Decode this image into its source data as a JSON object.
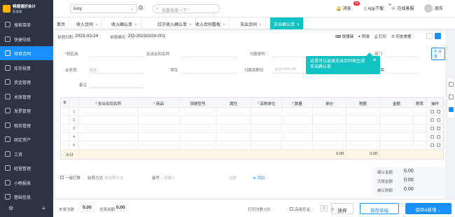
{
  "app": {
    "logo_name": "畅捷通好会计",
    "logo_edition": "标准版"
  },
  "topbar": {
    "company": "liuxy",
    "search_placeholder": "我要找单一下",
    "message_label": "消息",
    "message_count": "29",
    "app_label": "App下载",
    "service_label": "在线客服",
    "user_name": "周东"
  },
  "sidebar": {
    "items": [
      {
        "label": "搜索菜单"
      },
      {
        "label": "快捷导航"
      },
      {
        "label": "项目合同",
        "active": true
      },
      {
        "label": "库存核算"
      },
      {
        "label": "资金管理"
      },
      {
        "label": "总账管理"
      },
      {
        "label": "发票管理"
      },
      {
        "label": "税务管理"
      },
      {
        "label": "固定资产"
      },
      {
        "label": "工资"
      },
      {
        "label": "经营管理"
      },
      {
        "label": "小畅报表"
      },
      {
        "label": "基础信息"
      }
    ]
  },
  "tabs": [
    {
      "label": "首页",
      "closable": false
    },
    {
      "label": "收入合同",
      "closable": true
    },
    {
      "label": "收入确认单",
      "closable": true
    },
    {
      "label": "红字收入确认单",
      "closable": true
    },
    {
      "label": "收入合同看板",
      "closable": true
    },
    {
      "label": "支出合同",
      "closable": true
    },
    {
      "label": "支出确认单",
      "closable": true,
      "active": true
    }
  ],
  "form": {
    "date_label": "单据日期",
    "date_value": "2023-03-24",
    "code_label": "单据编码",
    "code_value": "ZQ-20230324-001",
    "toolbar": {
      "shortcut": "快捷键",
      "attach": "附单",
      "print": "打印",
      "history": "历史单据"
    },
    "setting": "设置",
    "row1": [
      {
        "label": "供应商",
        "required": true
      },
      {
        "label": "支出合同名称"
      },
      {
        "label": "付款条件"
      },
      {
        "label": "部门"
      }
    ],
    "row2": [
      {
        "label": "业务员",
        "placeholder": "请选..."
      },
      {
        "label": "项目"
      },
      {
        "label": "付款到期日",
        "placeholder": "yyyy-mm-dd"
      },
      {
        "label": "专用发票"
      }
    ],
    "remark_label": "备注"
  },
  "tip": {
    "line1": "这里可以选择支出合同来生成",
    "line2": "支出确认单"
  },
  "table": {
    "headers": [
      "支出合同名称",
      "商品",
      "规格型号",
      "属性",
      "采购单位",
      "数量",
      "单价",
      "税额",
      "金额",
      "税率",
      "操作"
    ],
    "rows": [
      "1",
      "2",
      "3",
      "4",
      "5"
    ],
    "subtotal_label": "小计",
    "subtotal_tax": "0.00",
    "subtotal_amount": "0.00"
  },
  "bottom": {
    "one_click": "一键打数",
    "settle_label": "结算方式",
    "settle_placeholder": "请选择方式",
    "bill_label": "备号",
    "bill_placeholder": "请输入",
    "amount_placeholder": "金额",
    "add_link": "添加"
  },
  "summary": {
    "confirm_amount_label": "确认金额",
    "confirm_amount": "0.00",
    "untaxed_label": "无税金额",
    "untaxed": "0.00",
    "confirm_tax_label": "确认税额",
    "confirm_tax": "0.00"
  },
  "footer": {
    "count_label": "本单次数",
    "count_value": "0.00",
    "prev_label": "往来余额",
    "prev_value": "0.00",
    "print_label": "打印次数:0次",
    "print_check_label": "高级开关:",
    "print_value": "0",
    "print_suffix": "补",
    "discard": "放弃",
    "save_draft": "保存草稿",
    "save_new": "保存&新增"
  }
}
